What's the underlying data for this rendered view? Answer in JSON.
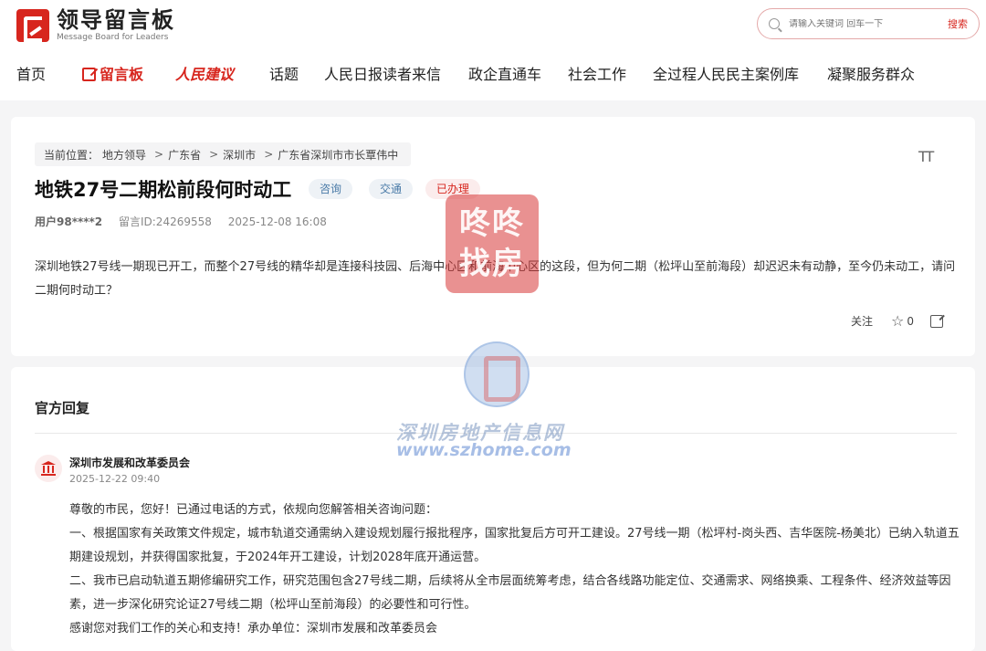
{
  "header": {
    "logo_title": "领导留言板",
    "logo_sub": "Message Board for Leaders",
    "search_placeholder": "请输入关键词 回车一下",
    "search_button": "搜索"
  },
  "nav": {
    "items": [
      "首页",
      "留言板",
      "人民建议",
      "话题",
      "人民日报读者来信",
      "政企直通车",
      "社会工作",
      "全过程人民民主案例库",
      "凝聚服务群众"
    ]
  },
  "breadcrumb": {
    "prefix": "当前位置：",
    "items": [
      "地方领导",
      "广东省",
      "深圳市",
      "广东省深圳市市长覃伟中"
    ],
    "separator": ">"
  },
  "post": {
    "title": "地铁27号二期松前段何时动工",
    "tags": [
      "咨询",
      "交通",
      "已办理"
    ],
    "user": "用户98****2",
    "message_id": "留言ID:24269558",
    "date": "2025-12-08 16:08",
    "body": "深圳地铁27号线一期现已开工，而整个27号线的精华却是连接科技园、后海中心区和前海中心区的这段，但为何二期（松坪山至前海段）却迟迟未有动静，至今仍未动工，请问二期何时动工？",
    "follow_label": "关注",
    "star_count": "0",
    "font_icon": "TT"
  },
  "reply": {
    "heading": "官方回复",
    "org_name": "深圳市发展和改革委员会",
    "date": "2025-12-22 09:40",
    "paragraphs": [
      "尊敬的市民，您好！已通过电话的方式，依规向您解答相关咨询问题：",
      "一、根据国家有关政策文件规定，城市轨道交通需纳入建设规划履行报批程序，国家批复后方可开工建设。27号线一期（松坪村-岗头西、吉华医院-杨美北）已纳入轨道五期建设规划，并获得国家批复，于2024年开工建设，计划2028年底开通运营。",
      "二、我市已启动轨道五期修编研究工作，研究范围包含27号线二期，后续将从全市层面统筹考虑，结合各线路功能定位、交通需求、网络换乘、工程条件、经济效益等因素，进一步深化研究论证27号线二期（松坪山至前海段）的必要性和可行性。",
      "感谢您对我们工作的关心和支持！承办单位：深圳市发展和改革委员会"
    ]
  },
  "watermarks": {
    "wm1_line1": "咚咚",
    "wm1_line2": "找房",
    "wm3": "深圳房地产信息网",
    "wm4": "www.szhome.com"
  },
  "colors": {
    "accent": "#d7261e",
    "tag_blue": "#4a7ba8"
  }
}
